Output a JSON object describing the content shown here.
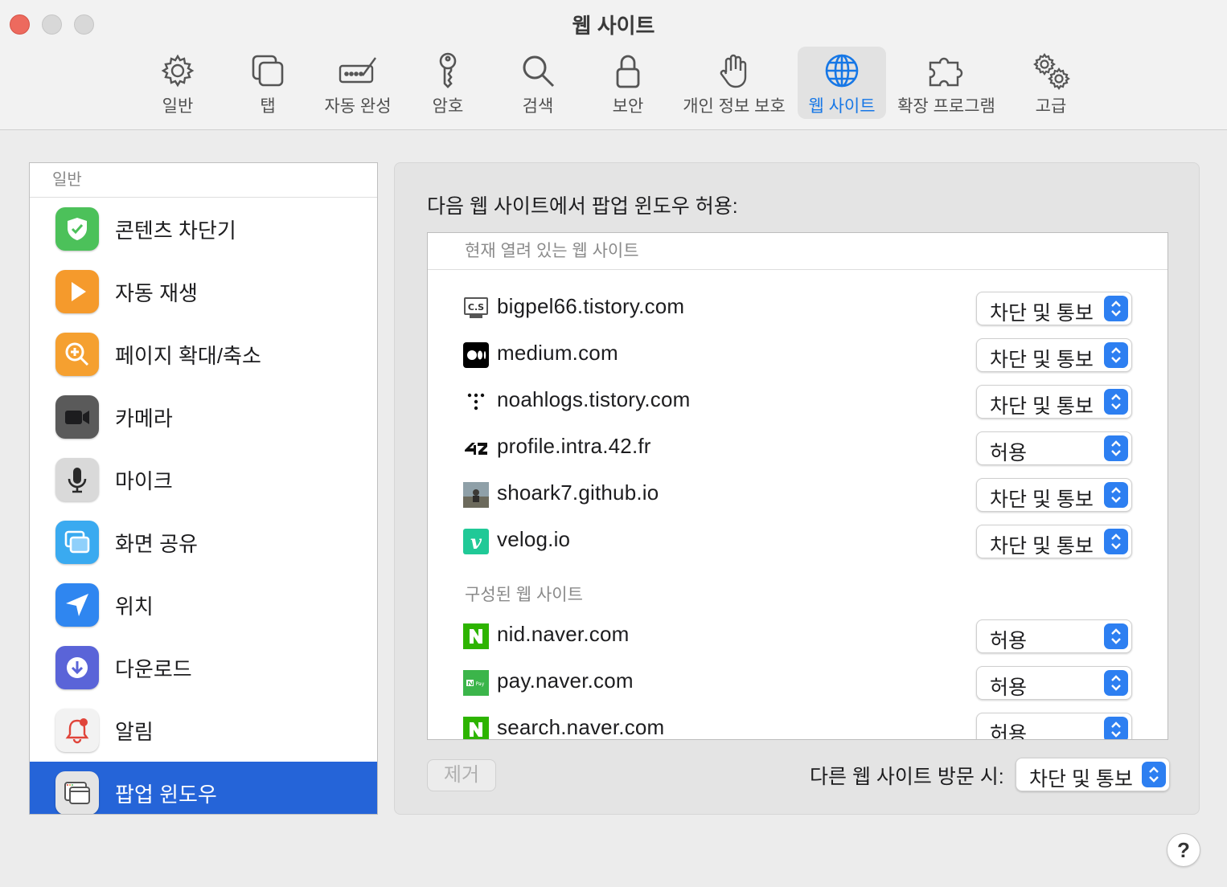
{
  "window": {
    "title": "웹 사이트"
  },
  "toolbar": {
    "items": [
      {
        "label": "일반",
        "icon": "gear-icon"
      },
      {
        "label": "탭",
        "icon": "tabs-icon"
      },
      {
        "label": "자동 완성",
        "icon": "autofill-icon"
      },
      {
        "label": "암호",
        "icon": "key-icon"
      },
      {
        "label": "검색",
        "icon": "search-icon"
      },
      {
        "label": "보안",
        "icon": "lock-icon"
      },
      {
        "label": "개인 정보 보호",
        "icon": "hand-icon"
      },
      {
        "label": "웹 사이트",
        "icon": "globe-icon",
        "active": true
      },
      {
        "label": "확장 프로그램",
        "icon": "puzzle-icon"
      },
      {
        "label": "고급",
        "icon": "gears-icon"
      }
    ]
  },
  "sidebar": {
    "header": "일반",
    "items": [
      {
        "label": "콘텐츠 차단기",
        "icon": "shield-check-icon",
        "color": "#4cc15a"
      },
      {
        "label": "자동 재생",
        "icon": "play-icon",
        "color": "#f59a2c"
      },
      {
        "label": "페이지 확대/축소",
        "icon": "zoom-icon",
        "color": "#f5a030"
      },
      {
        "label": "카메라",
        "icon": "camera-icon",
        "color": "#5a5a5a"
      },
      {
        "label": "마이크",
        "icon": "microphone-icon",
        "color": "#d9d9d9"
      },
      {
        "label": "화면 공유",
        "icon": "screen-share-icon",
        "color": "#3aaaf0"
      },
      {
        "label": "위치",
        "icon": "location-arrow-icon",
        "color": "#2f86f0"
      },
      {
        "label": "다운로드",
        "icon": "download-icon",
        "color": "#5a64d8"
      },
      {
        "label": "알림",
        "icon": "bell-icon",
        "color": "#f2f2f2"
      },
      {
        "label": "팝업 윈도우",
        "icon": "popup-window-icon",
        "color": "#e4e4e4",
        "selected": true
      }
    ]
  },
  "panel": {
    "heading": "다음 웹 사이트에서 팝업 윈도우 허용:",
    "section_open": "현재 열려 있는 웹 사이트",
    "section_configured": "구성된 웹 사이트",
    "open_sites": [
      {
        "domain": "bigpel66.tistory.com",
        "setting": "차단 및 통보",
        "favicon": "cs-monitor-icon"
      },
      {
        "domain": "medium.com",
        "setting": "차단 및 통보",
        "favicon": "medium-logo-icon"
      },
      {
        "domain": "noahlogs.tistory.com",
        "setting": "차단 및 통보",
        "favicon": "dots-logo-icon"
      },
      {
        "domain": "profile.intra.42.fr",
        "setting": "허용",
        "favicon": "42-logo-icon"
      },
      {
        "domain": "shoark7.github.io",
        "setting": "차단 및 통보",
        "favicon": "photo-avatar-icon"
      },
      {
        "domain": "velog.io",
        "setting": "차단 및 통보",
        "favicon": "velog-logo-icon"
      }
    ],
    "configured_sites": [
      {
        "domain": "nid.naver.com",
        "setting": "허용",
        "favicon": "naver-logo-icon"
      },
      {
        "domain": "pay.naver.com",
        "setting": "허용",
        "favicon": "naver-pay-logo-icon"
      },
      {
        "domain": "search.naver.com",
        "setting": "허용",
        "favicon": "naver-logo-icon"
      }
    ],
    "remove_label": "제거",
    "other_label": "다른 웹 사이트 방문 시:",
    "other_setting": "차단 및 통보"
  },
  "help": {
    "label": "?"
  },
  "colors": {
    "accent": "#2564d8",
    "popup_arrow": "#2d7ff1",
    "active_label": "#1677e6"
  }
}
